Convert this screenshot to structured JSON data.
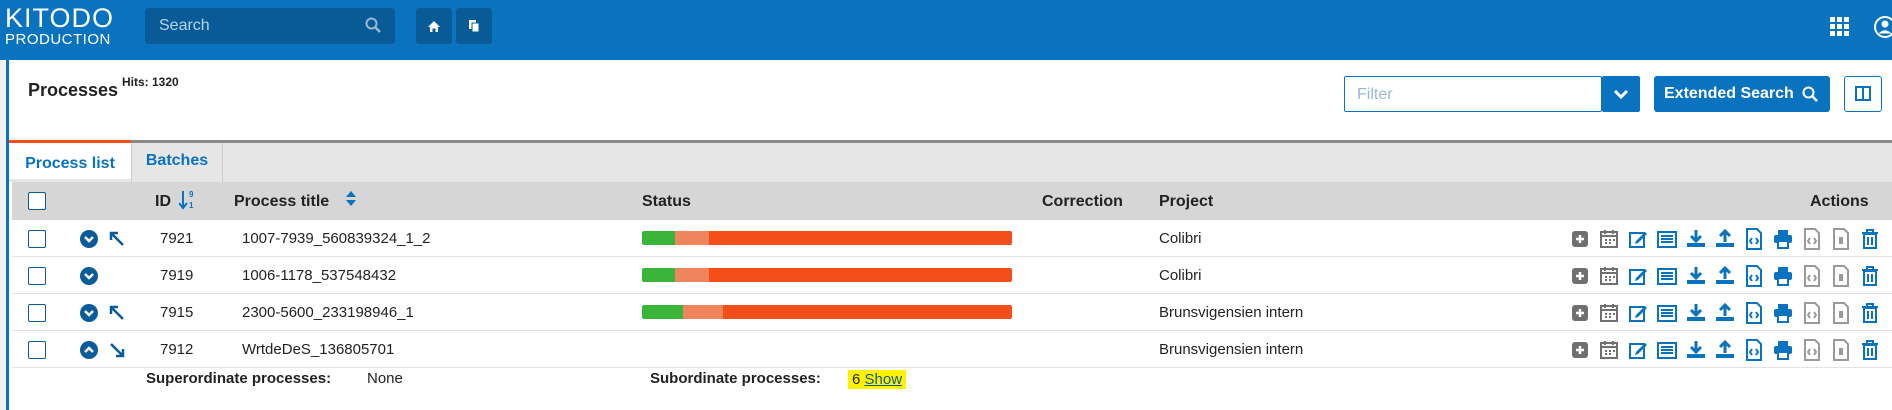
{
  "logo": {
    "line1": "KITODO",
    "line2": "PRODUCTION"
  },
  "search": {
    "placeholder": "Search"
  },
  "page": {
    "title": "Processes",
    "hits": "Hits: 1320"
  },
  "filter": {
    "placeholder": "Filter"
  },
  "extended_search_label": "Extended Search",
  "tabs": [
    {
      "label": "Process list"
    },
    {
      "label": "Batches"
    }
  ],
  "columns": {
    "id": "ID",
    "title": "Process title",
    "status": "Status",
    "correction": "Correction",
    "project": "Project",
    "actions": "Actions"
  },
  "rows": [
    {
      "id": "7921",
      "title": "1007-7939_560839324_1_2",
      "project": "Colibri",
      "expanded": false,
      "has_parent": true,
      "status": {
        "done": 0.09,
        "in_work": 0.09,
        "open": 0.82
      }
    },
    {
      "id": "7919",
      "title": "1006-1178_537548432",
      "project": "Colibri",
      "expanded": false,
      "has_parent": false,
      "status": {
        "done": 0.09,
        "in_work": 0.09,
        "open": 0.82
      }
    },
    {
      "id": "7915",
      "title": "2300-5600_233198946_1",
      "project": "Brunsvigensien intern",
      "expanded": false,
      "has_parent": true,
      "status": {
        "done": 0.11,
        "in_work": 0.11,
        "open": 0.78
      }
    },
    {
      "id": "7912",
      "title": "WrtdeDeS_136805701",
      "project": "Brunsvigensien intern",
      "expanded": true,
      "has_parent": false,
      "status": null
    }
  ],
  "details": {
    "superordinate_label": "Superordinate processes:",
    "superordinate_value": "None",
    "subordinate_label": "Subordinate processes:",
    "subordinate_count": "6",
    "subordinate_link": "Show"
  },
  "colors": {
    "header": "#0a73bf",
    "status_done": "#3ab53a",
    "status_in_work": "#f0845c",
    "status_open": "#f44e1b",
    "highlight": "#fff200"
  },
  "action_icons": [
    "add-icon",
    "calendar-icon",
    "edit-icon",
    "list-icon",
    "download-icon",
    "upload-icon",
    "xml-file-icon",
    "print-icon",
    "export-file-icon",
    "archive-file-icon",
    "delete-icon"
  ]
}
